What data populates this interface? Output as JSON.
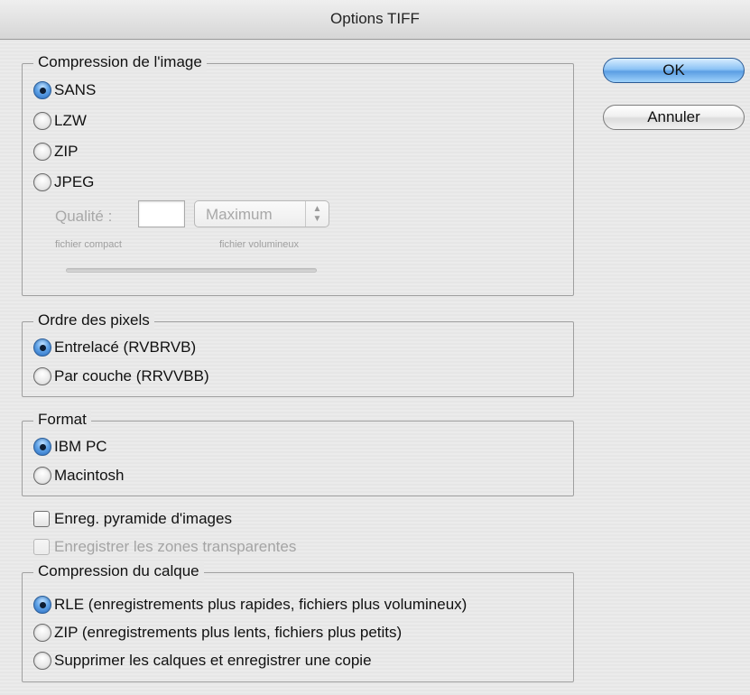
{
  "window": {
    "title": "Options TIFF"
  },
  "buttons": {
    "ok": "OK",
    "cancel": "Annuler"
  },
  "image_compression": {
    "label": "Compression de l'image",
    "options": [
      "SANS",
      "LZW",
      "ZIP",
      "JPEG"
    ],
    "selected": "SANS",
    "quality_label": "Qualité :",
    "quality_value": "",
    "quality_preset": "Maximum",
    "min_label": "fichier compact",
    "max_label": "fichier volumineux"
  },
  "pixel_order": {
    "label": "Ordre des pixels",
    "options": [
      "Entrelacé (RVBRVB)",
      "Par couche (RRVVBB)"
    ],
    "selected": "Entrelacé (RVBRVB)"
  },
  "byte_order": {
    "label": "Format",
    "options": [
      "IBM PC",
      "Macintosh"
    ],
    "selected": "IBM PC"
  },
  "checkboxes": {
    "save_pyramid": {
      "label": "Enreg. pyramide d'images",
      "checked": false,
      "enabled": true
    },
    "save_transparency": {
      "label": "Enregistrer les zones transparentes",
      "checked": false,
      "enabled": false
    }
  },
  "layer_compression": {
    "label": "Compression du calque",
    "options": [
      "RLE (enregistrements plus rapides, fichiers plus volumineux)",
      "ZIP (enregistrements plus lents, fichiers plus petits)",
      "Supprimer les calques et enregistrer une copie"
    ],
    "selected": "RLE (enregistrements plus rapides, fichiers plus volumineux)"
  },
  "colors": {
    "accent": "#5b9ee3",
    "background": "#e8e8e8",
    "disabled_text": "#a4a4a4"
  }
}
